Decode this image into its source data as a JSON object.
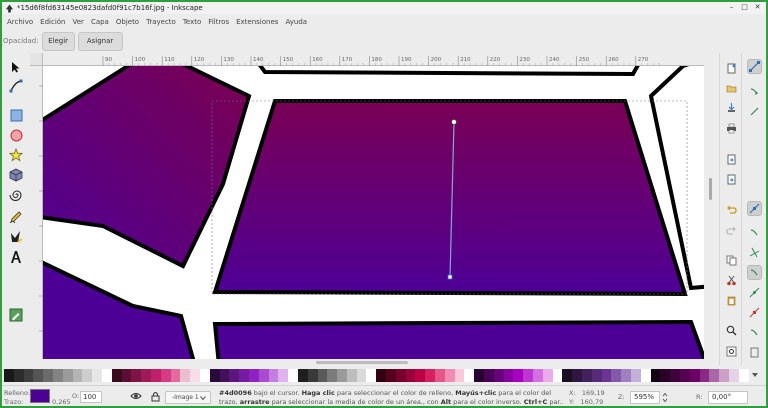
{
  "window": {
    "title": "*15d6f8fd63145e0823dafd0f91c7b16f.jpg - Inkscape",
    "minimize": "–",
    "maximize": "□",
    "close": "✕"
  },
  "menu": [
    "Archivo",
    "Edición",
    "Ver",
    "Capa",
    "Objeto",
    "Trayecto",
    "Texto",
    "Filtros",
    "Extensiones",
    "Ayuda"
  ],
  "toolcontrols": {
    "opacity_label": "Opacidad:",
    "pick_label": "Elegir",
    "assign_label": "Asignar"
  },
  "ruler": {
    "ticks": [
      "90",
      "100",
      "110",
      "120",
      "130",
      "140",
      "150",
      "160",
      "170",
      "180",
      "190",
      "200",
      "210",
      "220",
      "230",
      "240",
      "250",
      "260",
      "270"
    ]
  },
  "colors": {
    "accent": "#2e9f3a",
    "fill": "#4d0096",
    "gradient_top": "#7a0055",
    "gradient_bottom": "#4d0096"
  },
  "tools": [
    "selector-icon",
    "node-icon",
    "rect-icon",
    "circle-icon",
    "star-icon",
    "box3d-icon",
    "spiral-icon",
    "pencil-icon",
    "calligraphy-icon",
    "text-icon",
    "dropper-icon"
  ],
  "statusbar": {
    "fill_label": "Relleno:",
    "stroke_label": "Trazo:",
    "stroke_width": "0,265",
    "opacity_label": "O:",
    "opacity_value": "100",
    "layer": "-Image 1",
    "message_line1_color": "#4d0096",
    "message_line1_a": " bajo el cursor. ",
    "message_line1_b": "Haga clic",
    "message_line1_c": " para seleccionar el color de relleno, ",
    "message_line1_d": "Mayús+clic",
    "message_line1_e": " para el color del",
    "message_line2_a": "trazo, ",
    "message_line2_b": "arrastre",
    "message_line2_c": " para seleccionar la media de color de un área., con ",
    "message_line2_d": "Alt",
    "message_line2_e": " para el color inverso. ",
    "message_line2_f": "Ctrl+C",
    "message_line2_g": " par...",
    "x_label": "X:",
    "x_value": "169,19",
    "y_label": "Y:",
    "y_value": "160,79",
    "zoom_label": "Z:",
    "zoom_value": "595%",
    "rotate_label": "R:",
    "rotate_value": "0,00°"
  },
  "palette": [
    "#1a1a1a",
    "#2c2c2c",
    "#3f3f3f",
    "#555555",
    "#6b6b6b",
    "#838383",
    "#9b9b9b",
    "#b4b4b4",
    "#cdcdcd",
    "#e6e6e6",
    "#ffffff",
    "#3a0a1f",
    "#5c0f32",
    "#7d1445",
    "#9e1a58",
    "#bf206b",
    "#d83a84",
    "#e36a9f",
    "#ecbcd3",
    "#f6dde9",
    "#ffffff",
    "#2a0a3a",
    "#43105c",
    "#5c167e",
    "#751ca0",
    "#8e22c2",
    "#a94ad0",
    "#c47ee0",
    "#dfb3ef",
    "#ffffff",
    "#1f1f1f",
    "#3a3a3a",
    "#5a5a5a",
    "#7a7a7a",
    "#9a9a9a",
    "#bdbdbd",
    "#dadada",
    "#ffffff",
    "#330012",
    "#55001f",
    "#77002c",
    "#990039",
    "#bb0046",
    "#d6205f",
    "#e4558a",
    "#f08cb2",
    "#f9c8da",
    "#ffffff",
    "#2b0033",
    "#4a0057",
    "#69007b",
    "#88009f",
    "#a700c3",
    "#be35d3",
    "#d470e0",
    "#e9abee",
    "#ffffff",
    "#1b0d24",
    "#2f1740",
    "#43215c",
    "#572b78",
    "#6b3594",
    "#8458aa",
    "#a080c2",
    "#c4afd9",
    "#ffffff",
    "#140014",
    "#2a0028",
    "#40003c",
    "#560050",
    "#6c0064",
    "#8a2a86",
    "#a866a6",
    "#c8a0c8",
    "#e6d2e6",
    "#ffffff"
  ]
}
